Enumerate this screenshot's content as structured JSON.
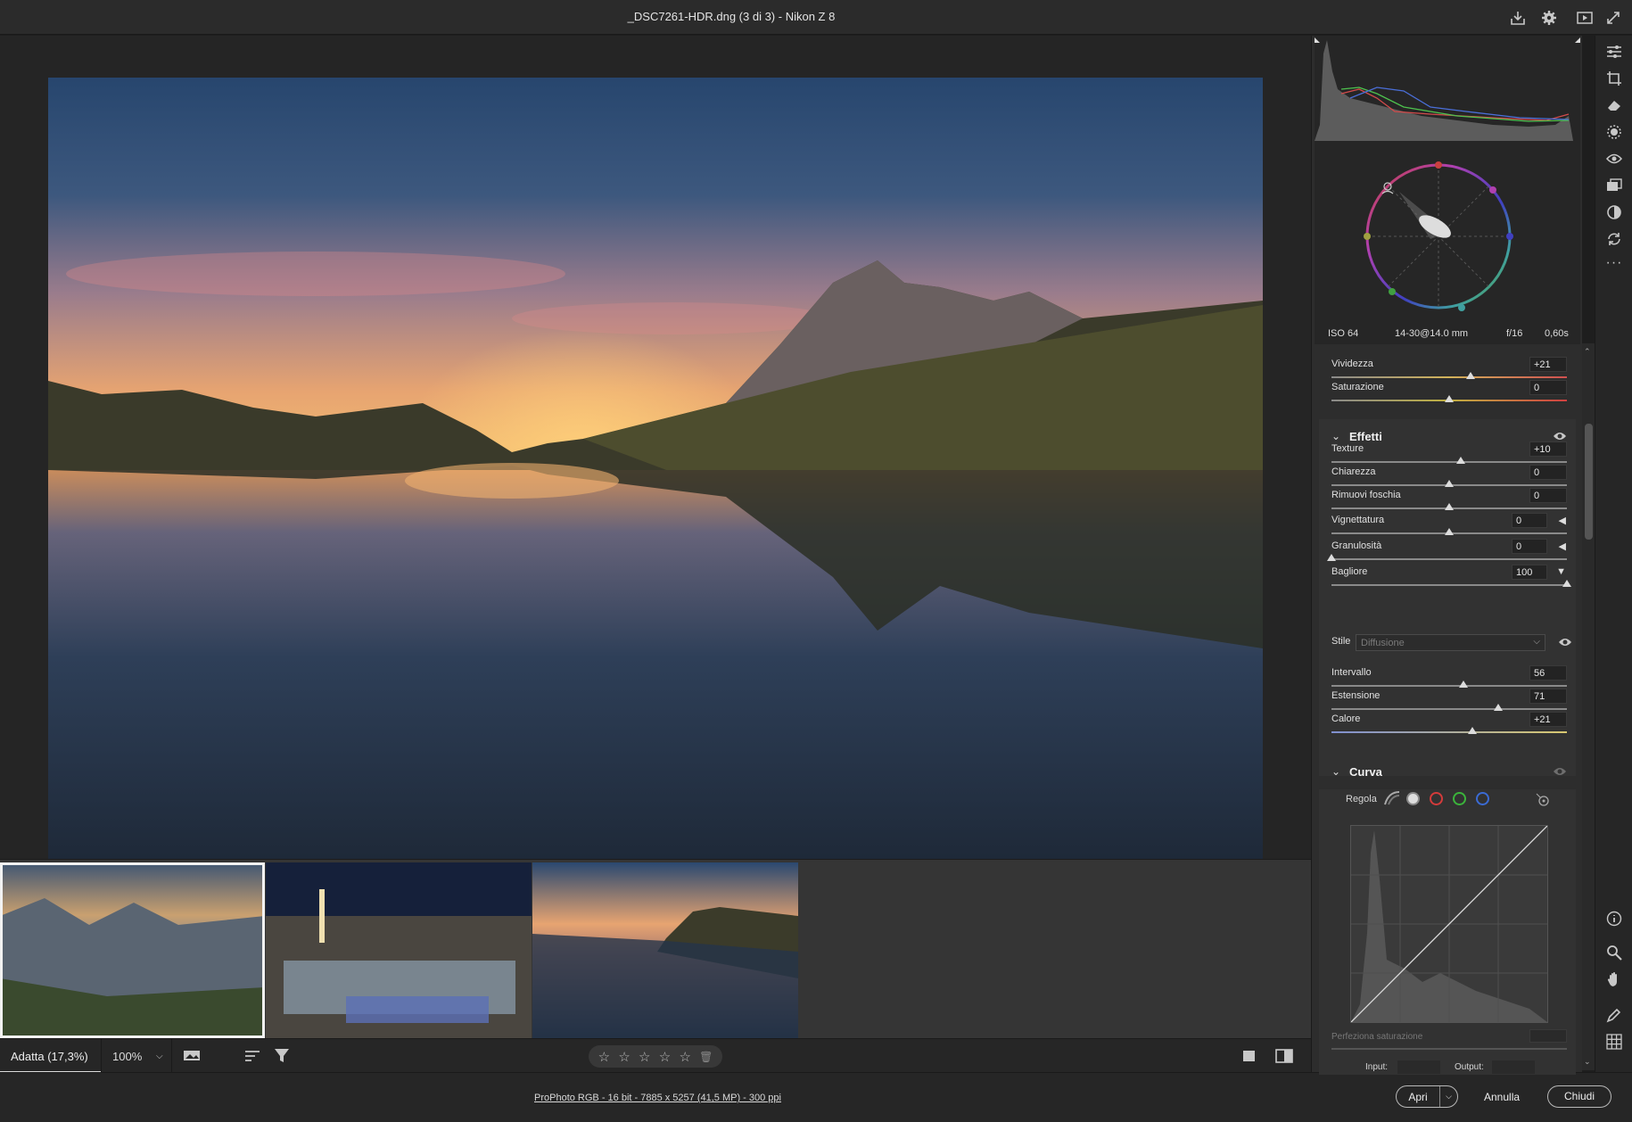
{
  "window": {
    "title": "_DSC7261-HDR.dng (3 di 3)  -  Nikon Z 8"
  },
  "titlebar_icons": [
    "download-icon",
    "gear-icon",
    "play-icon",
    "expand-icon"
  ],
  "bottombar": {
    "zoom_fit": "Adatta (17,3%)",
    "zoom_pct": "100%",
    "stars": [
      "☆",
      "☆",
      "☆",
      "☆",
      "☆"
    ]
  },
  "footer": {
    "image_info": "ProPhoto RGB - 16 bit - 7885 x 5257 (41,5 MP) - 300 ppi",
    "open": "Apri",
    "cancel": "Annulla",
    "close": "Chiudi"
  },
  "exif": {
    "iso": "ISO 64",
    "lens": "14-30@14.0 mm",
    "aperture": "f/16",
    "shutter": "0,60s"
  },
  "color_sliders": [
    {
      "label": "Vividezza",
      "value": "+21",
      "level": 0.59
    },
    {
      "label": "Saturazione",
      "value": "0",
      "level": 0.5
    }
  ],
  "effects": {
    "title": "Effetti",
    "sliders": [
      {
        "label": "Texture",
        "value": "+10",
        "level": 0.55
      },
      {
        "label": "Chiarezza",
        "value": "0",
        "level": 0.5
      },
      {
        "label": "Rimuovi foschia",
        "value": "0",
        "level": 0.5
      },
      {
        "label": "Vignettatura",
        "value": "0",
        "level": 0.5
      },
      {
        "label": "Granulosità",
        "value": "0",
        "level": 0.0
      },
      {
        "label": "Bagliore",
        "value": "100",
        "level": 1.0
      }
    ],
    "style_label": "Stile",
    "style_value": "Diffusione",
    "glow_sliders": [
      {
        "label": "Intervallo",
        "value": "56",
        "level": 0.56
      },
      {
        "label": "Estensione",
        "value": "71",
        "level": 0.71
      },
      {
        "label": "Calore",
        "value": "+21",
        "level": 0.6
      }
    ]
  },
  "curve": {
    "title": "Curva",
    "adjust_label": "Regola",
    "refine_label": "Perfeziona saturazione",
    "input_label": "Input:",
    "output_label": "Output:"
  },
  "colors": {
    "accent": "#e8e8e8",
    "panel": "#2d2d2d"
  }
}
